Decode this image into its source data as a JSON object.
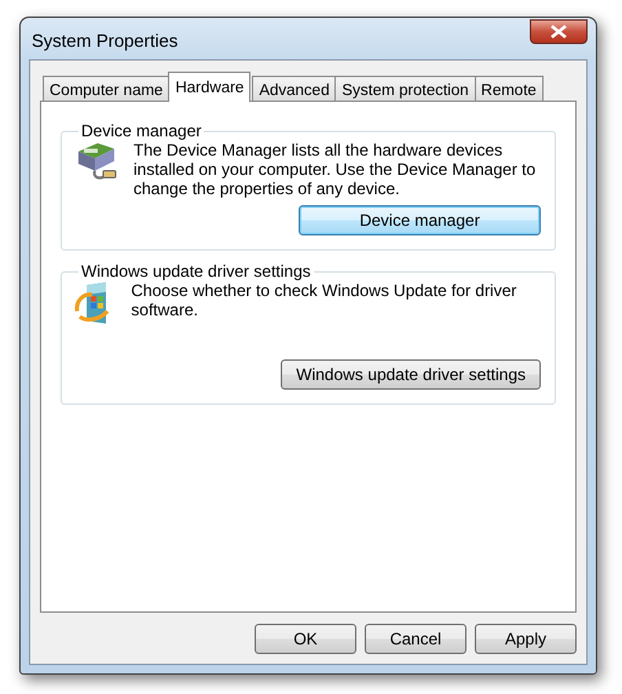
{
  "window": {
    "title": "System Properties"
  },
  "tabs": [
    {
      "label": "Computer name",
      "selected": false
    },
    {
      "label": "Hardware",
      "selected": true
    },
    {
      "label": "Advanced",
      "selected": false
    },
    {
      "label": "System protection",
      "selected": false
    },
    {
      "label": "Remote",
      "selected": false
    }
  ],
  "groups": [
    {
      "kind": "device",
      "title": "Device manager",
      "text": "The Device Manager lists all the hardware devices installed on your computer. Use the Device Manager to change the properties of any device.",
      "button": {
        "label": "Device manager",
        "focused": true
      }
    },
    {
      "kind": "update",
      "title": "Windows update driver settings",
      "text": "Choose whether to check Windows Update for driver software.",
      "button": {
        "label": "Windows update driver settings",
        "focused": false
      }
    }
  ],
  "buttons": [
    "OK",
    "Cancel",
    "Apply"
  ]
}
